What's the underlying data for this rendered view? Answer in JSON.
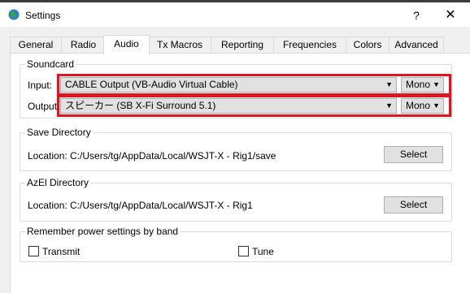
{
  "window": {
    "title": "Settings",
    "help_label": "?",
    "close_label": "✕"
  },
  "tabs": [
    "General",
    "Radio",
    "Audio",
    "Tx Macros",
    "Reporting",
    "Frequencies",
    "Colors",
    "Advanced"
  ],
  "active_tab": "Audio",
  "soundcard": {
    "title": "Soundcard",
    "input_label": "Input:",
    "input_value": "CABLE Output (VB-Audio Virtual Cable)",
    "input_channel": "Mono",
    "output_label": "Output:",
    "output_value": "スピーカー (SB X-Fi Surround 5.1)",
    "output_channel": "Mono"
  },
  "save_directory": {
    "title": "Save Directory",
    "location": "Location:  C:/Users/tg/AppData/Local/WSJT-X - Rig1/save",
    "select_label": "Select"
  },
  "azel_directory": {
    "title": "AzEl Directory",
    "location": "Location:  C:/Users/tg/AppData/Local/WSJT-X - Rig1",
    "select_label": "Select"
  },
  "power": {
    "title": "Remember power settings by band",
    "transmit_label": "Transmit",
    "tune_label": "Tune",
    "transmit_checked": false,
    "tune_checked": false
  },
  "colors": {
    "highlight": "#e0141e"
  }
}
